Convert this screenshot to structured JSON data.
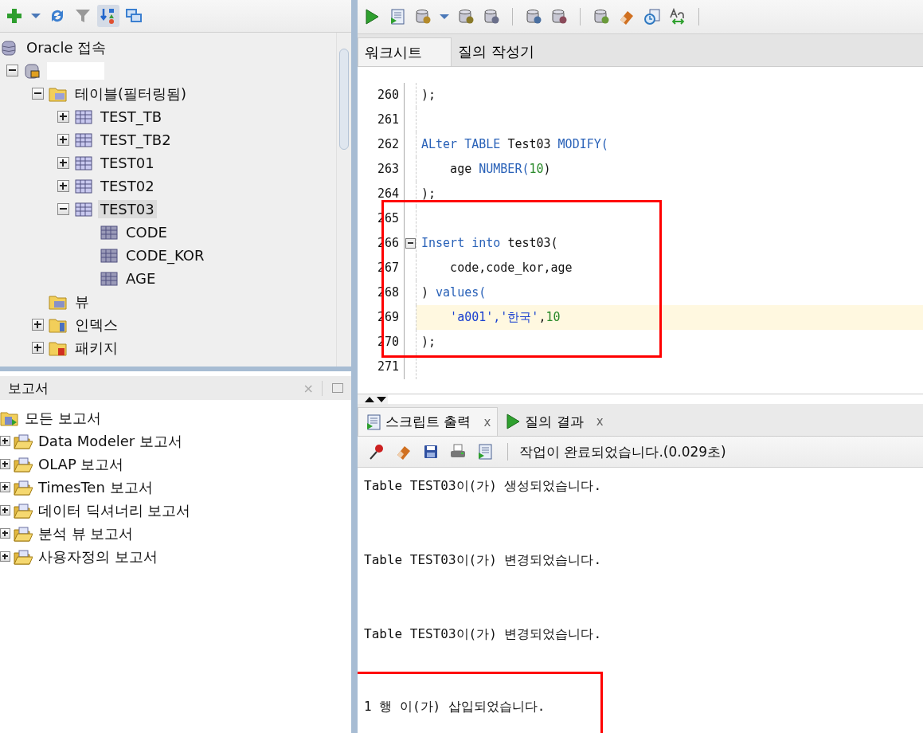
{
  "connections_toolbar": {
    "buttons": [
      {
        "kind": "add"
      },
      {
        "kind": "dropdown"
      },
      {
        "kind": "refresh"
      },
      {
        "kind": "filter"
      },
      {
        "kind": "schema",
        "selected": true
      },
      {
        "kind": "collapse"
      }
    ]
  },
  "connections_tree": {
    "items": [
      {
        "label": "Oracle 접속",
        "kind": "database",
        "selected": false,
        "children": [
          {
            "redacted": true,
            "kind": "connection",
            "expanded": true,
            "selected": false,
            "children": [
              {
                "label": "테이블(필터링됨)",
                "kind": "table-folder",
                "expanded": true,
                "selected": false,
                "children": [
                  {
                    "label": "TEST_TB",
                    "kind": "table",
                    "expanded": false,
                    "selected": false
                  },
                  {
                    "label": "TEST_TB2",
                    "kind": "table",
                    "expanded": false,
                    "selected": false
                  },
                  {
                    "label": "TEST01",
                    "kind": "table",
                    "expanded": false,
                    "selected": false
                  },
                  {
                    "label": "TEST02",
                    "kind": "table",
                    "expanded": false,
                    "selected": false
                  },
                  {
                    "label": "TEST03",
                    "kind": "table",
                    "expanded": true,
                    "selected": true,
                    "children": [
                      {
                        "label": "CODE",
                        "kind": "column",
                        "selected": false
                      },
                      {
                        "label": "CODE_KOR",
                        "kind": "column",
                        "selected": false
                      },
                      {
                        "label": "AGE",
                        "kind": "column",
                        "selected": false
                      }
                    ]
                  }
                ]
              },
              {
                "label": "뷰",
                "kind": "view-folder",
                "selected": false
              },
              {
                "label": "인덱스",
                "kind": "index-folder",
                "expanded": false,
                "selected": false
              },
              {
                "label": "패키지",
                "kind": "package-folder",
                "expanded": false,
                "selected": false
              }
            ]
          }
        ]
      }
    ]
  },
  "reports_panel": {
    "title": "보고서",
    "close": "×",
    "items": [
      {
        "label": "모든 보고서",
        "kind": "reports",
        "selected": false,
        "children": [
          {
            "label": "Data Modeler 보고서",
            "kind": "report-folder",
            "expanded": false,
            "selected": false
          },
          {
            "label": "OLAP 보고서",
            "kind": "report-folder",
            "expanded": false,
            "selected": false
          },
          {
            "label": "TimesTen 보고서",
            "kind": "report-folder",
            "expanded": false,
            "selected": false
          },
          {
            "label": "데이터 딕셔너리 보고서",
            "kind": "report-folder",
            "expanded": false,
            "selected": false
          },
          {
            "label": "분석 뷰 보고서",
            "kind": "report-folder",
            "expanded": false,
            "selected": false
          },
          {
            "label": "사용자정의 보고서",
            "kind": "report-folder",
            "expanded": false,
            "selected": false
          }
        ]
      }
    ]
  },
  "editor_toolbar": {
    "buttons": [
      {
        "kind": "run"
      },
      {
        "kind": "run-script"
      },
      {
        "kind": "db-config"
      },
      {
        "kind": "dropdown"
      },
      {
        "kind": "db-run"
      },
      {
        "kind": "db-search"
      },
      {
        "kind": "sep"
      },
      {
        "kind": "commit"
      },
      {
        "kind": "rollback"
      },
      {
        "kind": "sep"
      },
      {
        "kind": "sql-tuning"
      },
      {
        "kind": "eraser"
      },
      {
        "kind": "history"
      },
      {
        "kind": "case"
      },
      {
        "kind": "sep"
      }
    ]
  },
  "editor_tabs": [
    {
      "label": "워크시트",
      "selected": true
    },
    {
      "label": "질의 작성기",
      "selected": false
    }
  ],
  "editor": {
    "lines": [
      {
        "number": "260",
        "current": false,
        "tokens": [
          {
            "text": ");",
            "kind": "plain"
          }
        ]
      },
      {
        "number": "261",
        "current": false
      },
      {
        "number": "262",
        "current": false,
        "tokens": [
          {
            "text": "ALter TABLE ",
            "kind": "keyword"
          },
          {
            "text": "Test03 ",
            "kind": "plain"
          },
          {
            "text": "MODIFY(",
            "kind": "keyword"
          }
        ]
      },
      {
        "number": "263",
        "current": false,
        "tokens": [
          {
            "text": "    age ",
            "kind": "plain"
          },
          {
            "text": "NUMBER(",
            "kind": "keyword"
          },
          {
            "text": "10",
            "kind": "number"
          },
          {
            "text": ")",
            "kind": "plain"
          }
        ]
      },
      {
        "number": "264",
        "current": false,
        "tokens": [
          {
            "text": ");",
            "kind": "plain"
          }
        ]
      }
    ],
    "annotated_lines": [
      {
        "number": "265",
        "current": false
      },
      {
        "number": "266",
        "current": false,
        "fold": true,
        "tokens": [
          {
            "text": "Insert into ",
            "kind": "keyword"
          },
          {
            "text": "test03(",
            "kind": "plain"
          }
        ]
      },
      {
        "number": "267",
        "current": false,
        "tokens": [
          {
            "text": "    code,code_kor,age",
            "kind": "plain"
          }
        ]
      },
      {
        "number": "268",
        "current": false,
        "tokens": [
          {
            "text": ") ",
            "kind": "plain"
          },
          {
            "text": "values(",
            "kind": "keyword"
          }
        ]
      },
      {
        "number": "269",
        "current": true,
        "tokens": [
          {
            "text": "    'a001','한국'",
            "kind": "string"
          },
          {
            "text": ",",
            "kind": "plain"
          },
          {
            "text": "10",
            "kind": "number"
          }
        ]
      },
      {
        "number": "270",
        "current": false,
        "tokens": [
          {
            "text": ");",
            "kind": "plain"
          }
        ]
      },
      {
        "number": "271",
        "current": false
      }
    ]
  },
  "output_tabs": [
    {
      "label": "스크립트 출력",
      "kind": "script",
      "close": "x",
      "selected": true
    },
    {
      "label": "질의 결과",
      "kind": "run",
      "close": "x",
      "selected": false
    }
  ],
  "output_toolbar": {
    "buttons": [
      {
        "kind": "pin"
      },
      {
        "kind": "eraser"
      },
      {
        "kind": "save"
      },
      {
        "kind": "print"
      },
      {
        "kind": "script"
      }
    ],
    "status": "작업이 완료되었습니다.(0.029초)"
  },
  "output": {
    "messages": [
      {
        "text": "Table TEST03이(가) 생성되었습니다.",
        "marked": false
      },
      {
        "text": "Table TEST03이(가) 변경되었습니다.",
        "marked": false
      },
      {
        "text": "Table TEST03이(가) 변경되었습니다.",
        "marked": false
      },
      {
        "text": "1 행 이(가) 삽입되었습니다.",
        "marked": true
      }
    ]
  }
}
